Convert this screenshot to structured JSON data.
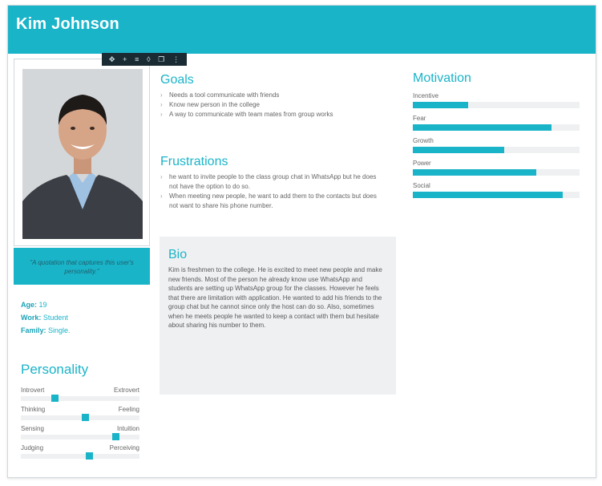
{
  "header": {
    "title": "Kim Johnson"
  },
  "toolbar": {
    "icons": [
      "move-icon",
      "plus-icon",
      "align-icon",
      "drop-icon",
      "copy-icon",
      "more-icon"
    ]
  },
  "profile": {
    "quote": "\"A quotation that captures this user's personality.\"",
    "facts": [
      {
        "key": "Age:",
        "value": "19"
      },
      {
        "key": "Work:",
        "value": "Student"
      },
      {
        "key": "Family:",
        "value": "Single."
      }
    ]
  },
  "personality": {
    "title": "Personality",
    "traits": [
      {
        "left": "Introvert",
        "right": "Extrovert",
        "level": 0.27
      },
      {
        "left": "Thinking",
        "right": "Feeling",
        "level": 0.55
      },
      {
        "left": "Sensing",
        "right": "Intuition",
        "level": 0.82
      },
      {
        "left": "Judging",
        "right": "Perceiving",
        "level": 0.58
      }
    ]
  },
  "goals": {
    "title": "Goals",
    "items": [
      "Needs a tool communicate with friends",
      "Know new person in the college",
      "A way to communicate with team mates from group works"
    ]
  },
  "frustrations": {
    "title": "Frustrations",
    "items": [
      "he want to invite people to the class group chat in WhatsApp but he does not have the option to do so.",
      "When meeting new people, he want to add them to the contacts but does not want to share his phone number."
    ]
  },
  "bio": {
    "title": "Bio",
    "text": "Kim is freshmen to the college. He is excited to meet new people and make new friends. Most of the person he already know use WhatsApp and students are setting up WhatsApp group for the classes. However he feels that there are limitation with application. He wanted to add his friends to the group chat but he cannot since only the host can do so. Also, sometimes when he meets people he wanted to keep a contact with them but hesitate about sharing his number to them."
  },
  "motivation": {
    "title": "Motivation",
    "items": [
      {
        "label": "Incentive",
        "level": 0.33
      },
      {
        "label": "Fear",
        "level": 0.83
      },
      {
        "label": "Growth",
        "level": 0.55
      },
      {
        "label": "Power",
        "level": 0.74
      },
      {
        "label": "Social",
        "level": 0.9
      }
    ]
  },
  "colors": {
    "accent": "#1ab4c9",
    "toolbar": "#1b2b33",
    "panel": "#eef0f2"
  }
}
